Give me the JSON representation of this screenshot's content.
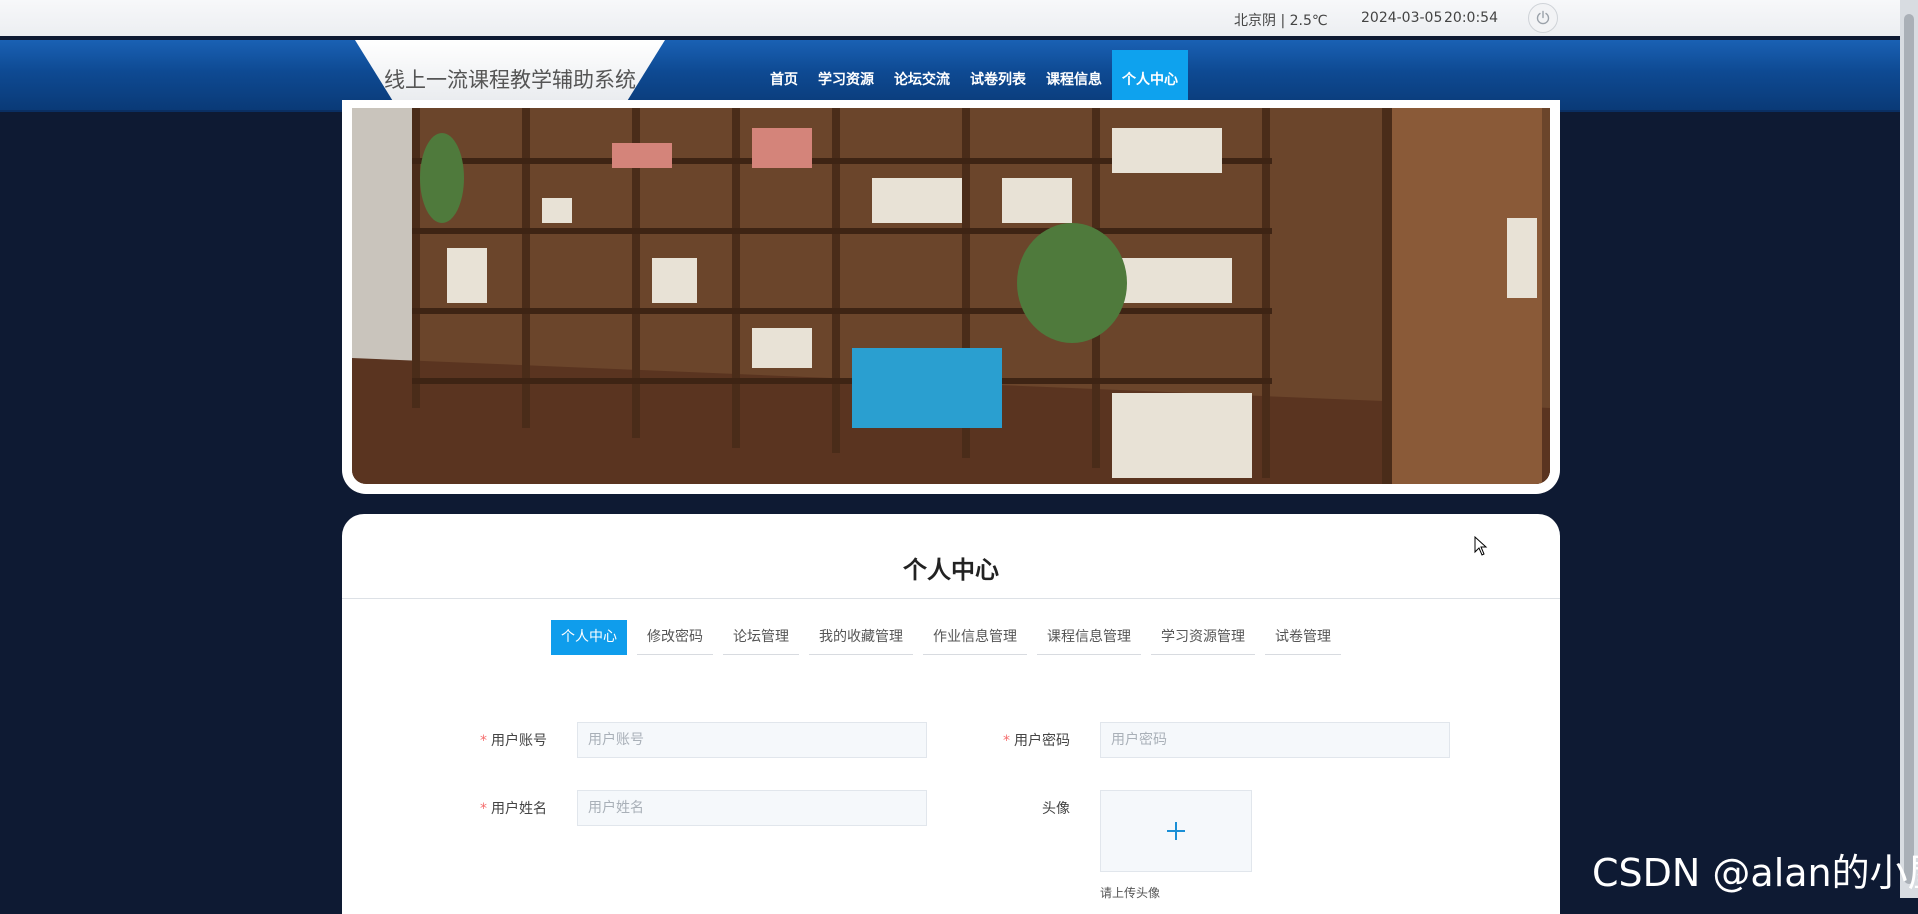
{
  "topbar": {
    "weather": "北京阴 | 2.5℃",
    "date": "2024-03-05",
    "time": "20:0:54",
    "power_icon": "power-icon"
  },
  "brand": {
    "title": "线上一流课程教学辅助系统"
  },
  "menu": {
    "items": [
      {
        "label": "首页",
        "active": false
      },
      {
        "label": "学习资源",
        "active": false
      },
      {
        "label": "论坛交流",
        "active": false
      },
      {
        "label": "试卷列表",
        "active": false
      },
      {
        "label": "课程信息",
        "active": false
      },
      {
        "label": "个人中心",
        "active": true
      }
    ]
  },
  "card": {
    "title": "个人中心"
  },
  "tabs": [
    {
      "label": "个人中心",
      "active": true
    },
    {
      "label": "修改密码"
    },
    {
      "label": "论坛管理"
    },
    {
      "label": "我的收藏管理"
    },
    {
      "label": "作业信息管理"
    },
    {
      "label": "课程信息管理"
    },
    {
      "label": "学习资源管理"
    },
    {
      "label": "试卷管理"
    }
  ],
  "form": {
    "account": {
      "label": "用户账号",
      "placeholder": "用户账号",
      "required": "*"
    },
    "password": {
      "label": "用户密码",
      "placeholder": "用户密码",
      "required": "*"
    },
    "name": {
      "label": "用户姓名",
      "placeholder": "用户姓名",
      "required": "*"
    },
    "avatar": {
      "label": "头像",
      "tip": "请上传头像",
      "icon": "plus-icon"
    }
  },
  "watermark": "CSDN @alan的小屋",
  "colors": {
    "nav": "#0e4a93",
    "accent": "#0f9dec",
    "background": "#0e1a33"
  }
}
